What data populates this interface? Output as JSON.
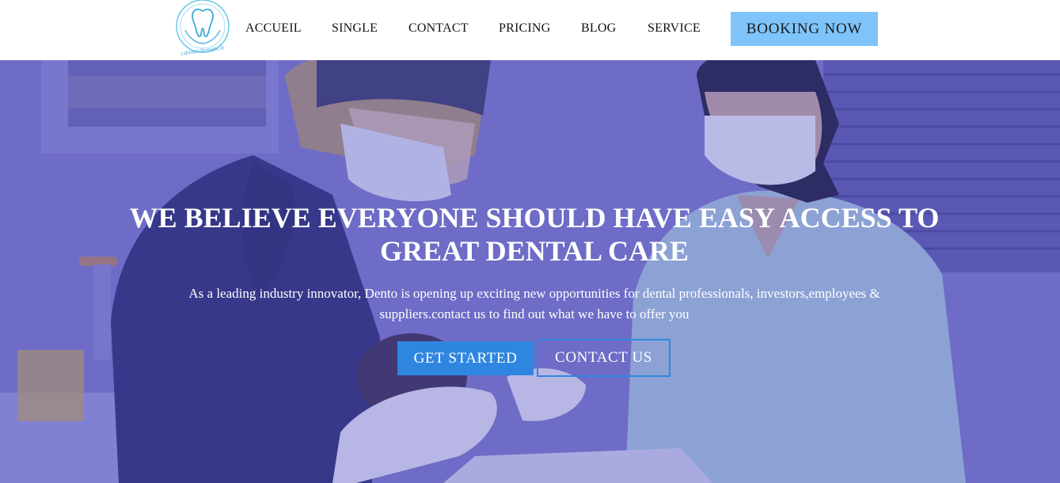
{
  "header": {
    "logo_text": "cabinet-dentaire.fr",
    "nav": [
      {
        "label": "ACCUEIL"
      },
      {
        "label": "SINGLE"
      },
      {
        "label": "CONTACT"
      },
      {
        "label": "PRICING"
      },
      {
        "label": "BLOG"
      },
      {
        "label": "SERVICE"
      }
    ],
    "booking_label": "BOOKING NOW"
  },
  "hero": {
    "title": "WE BELIEVE EVERYONE SHOULD HAVE EASY ACCESS TO GREAT DENTAL CARE",
    "subtitle": "As a leading industry innovator, Dento is opening up exciting new opportunities for dental professionals, investors,employees & suppliers.contact us to find out what we have to offer you",
    "primary_button": "GET STARTED",
    "secondary_button": "CONTACT US",
    "background_image": "dentists-treating-patient-photo"
  },
  "colors": {
    "booking_bg": "#7ec4fb",
    "primary_button_bg": "#2f86e0",
    "outline_border": "#2f86e0",
    "hero_overlay": "#524ebe"
  }
}
